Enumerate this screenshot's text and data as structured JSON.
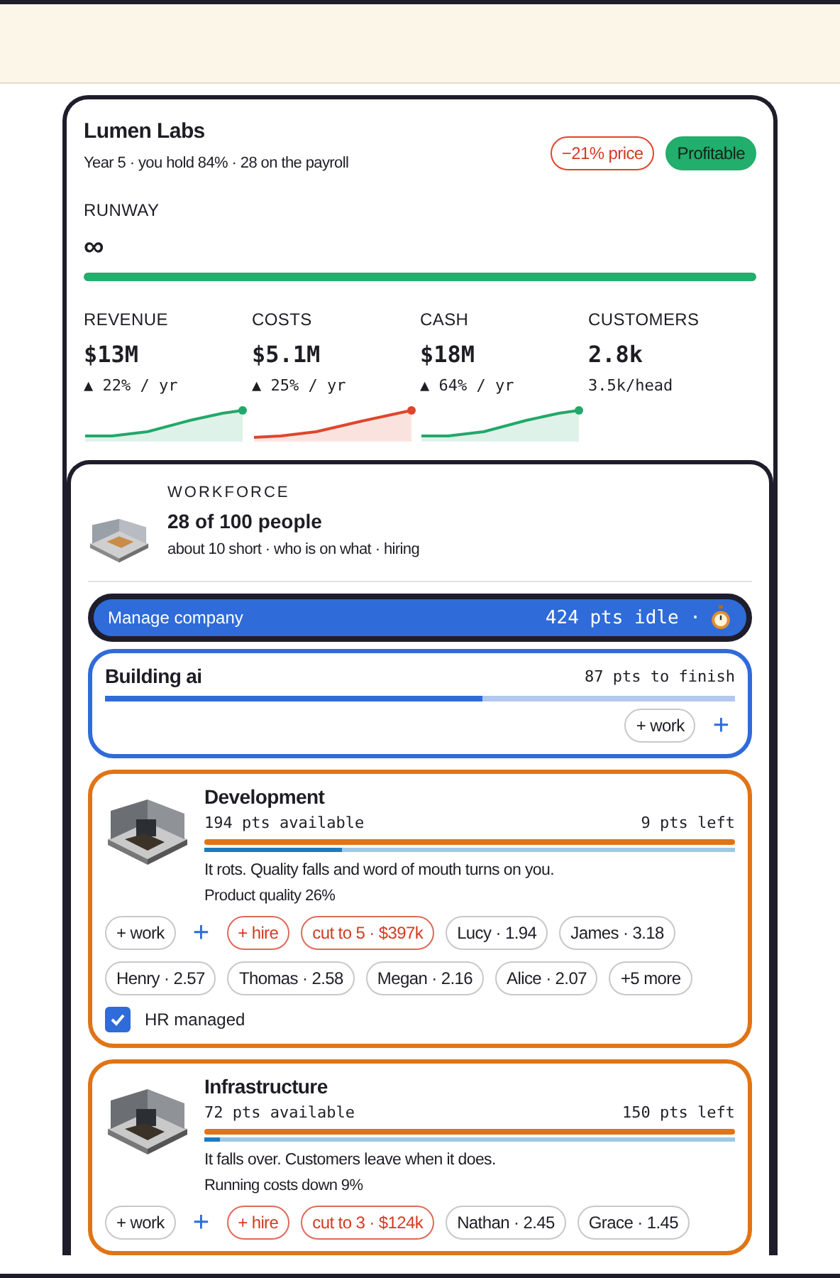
{
  "company": {
    "name": "Lumen Labs",
    "subtitle": "Year 5 · you hold 84% · 28 on the payroll",
    "badges": [
      {
        "label": "−21% price",
        "kind": "warning"
      },
      {
        "label": "Profitable",
        "kind": "good"
      }
    ],
    "runway": {
      "label": "RUNWAY",
      "value": "∞",
      "level": 1
    },
    "stats": [
      {
        "label": "REVENUE",
        "value": "$13M",
        "change": "▲ 22% / yr",
        "kind": "good"
      },
      {
        "label": "COSTS",
        "value": "$5.1M",
        "change": "▲ 25% / yr",
        "kind": "bad"
      },
      {
        "label": "CASH",
        "value": "$18M",
        "change": "▲ 64% / yr",
        "kind": "good"
      },
      {
        "label": "CUSTOMERS",
        "value": "2.8k",
        "change": "3.5k/head",
        "kind": "plain"
      }
    ]
  },
  "workforce": {
    "label": "WORKFORCE",
    "title": "28 of 100 people",
    "subtitle": "about 10 short · who is on what · hiring",
    "manage": {
      "label": "Manage company",
      "idle": "424 pts idle ·"
    },
    "sections": [
      {
        "kind": "project",
        "title": "Building ai",
        "remaining": "87 pts to finish",
        "level": 0.6,
        "work": "+ work",
        "add": "+"
      },
      {
        "kind": "department",
        "title": "Development",
        "available": "194 pts available",
        "remaining": "9 pts left",
        "level": 0.26,
        "description": "It rots. Quality falls and word of mouth turns on you.",
        "effect": "Product quality 26%",
        "work": "+ work",
        "add": "+",
        "chips": [
          {
            "label": "+ hire",
            "kind": "action"
          },
          {
            "label": "cut to 5 · $397k",
            "kind": "action"
          },
          {
            "label": "Lucy · 1.94",
            "kind": "person"
          },
          {
            "label": "James · 3.18",
            "kind": "person"
          },
          {
            "label": "Henry · 2.57",
            "kind": "person"
          },
          {
            "label": "Thomas · 2.58",
            "kind": "person"
          },
          {
            "label": "Megan · 2.16",
            "kind": "person"
          },
          {
            "label": "Alice · 2.07",
            "kind": "person"
          },
          {
            "label": "+5 more",
            "kind": "person"
          }
        ],
        "hr_managed": {
          "label": "HR managed",
          "checked": true
        }
      },
      {
        "kind": "department",
        "title": "Infrastructure",
        "available": "72 pts available",
        "remaining": "150 pts left",
        "level": 0.03,
        "description": "It falls over. Customers leave when it does.",
        "effect": "Running costs down 9%",
        "work": "+ work",
        "add": "+",
        "chips": [
          {
            "label": "+ hire",
            "kind": "action"
          },
          {
            "label": "cut to 3 · $124k",
            "kind": "action"
          },
          {
            "label": "Nathan · 2.45",
            "kind": "person"
          },
          {
            "label": "Grace · 1.45",
            "kind": "person"
          }
        ]
      }
    ]
  }
}
